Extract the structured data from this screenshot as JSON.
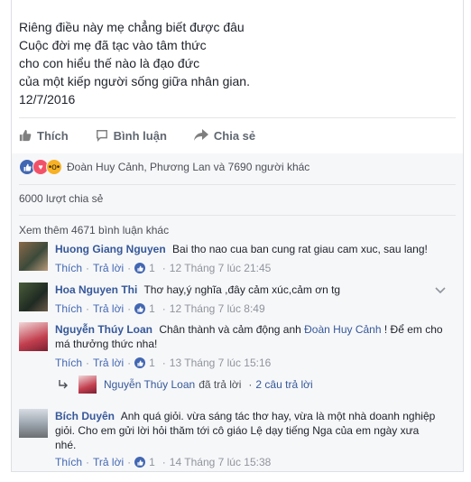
{
  "post": {
    "poem_lines": [
      "Riêng điều này mẹ chẳng biết được đâu",
      "Cuộc đời mẹ đã tạc vào tâm thức",
      "cho con hiểu thế nào là đạo đức",
      "của một kiếp người sống giữa nhân gian.",
      "12/7/2016"
    ]
  },
  "actions": {
    "like": "Thích",
    "comment": "Bình luận",
    "share": "Chia sẻ"
  },
  "reactions": {
    "names": "Đoàn Huy Cảnh, Phương Lan và 7690 người khác"
  },
  "shares": "6000 lượt chia sẻ",
  "more_comments": "Xem thêm 4671 bình luận khác",
  "comments": [
    {
      "name": "Huong Giang Nguyen",
      "text": "Bai tho nao cua ban cung rat giau cam xuc, sau lang!",
      "like_label": "Thích",
      "reply_label": "Trả lời",
      "likes": "1",
      "time": "12 Tháng 7 lúc 21:45"
    },
    {
      "name": "Hoa Nguyen Thi",
      "text": "Thơ hay,ý nghĩa ,đây cảm xúc,cảm ơn tg",
      "like_label": "Thích",
      "reply_label": "Trả lời",
      "likes": "1",
      "time": "12 Tháng 7 lúc 8:49"
    },
    {
      "name": "Nguyễn Thúy Loan",
      "text_before": "Chân thành và cảm động anh",
      "tag": "Đoàn Huy Cảnh",
      "text_after": "! Để em cho má thưởng thức nha!",
      "like_label": "Thích",
      "reply_label": "Trả lời",
      "likes": "1",
      "time": "13 Tháng 7 lúc 15:16",
      "reply_summary": {
        "name": "Nguyễn Thúy Loan",
        "action": "đã trả lời",
        "count": "2 câu trả lời"
      }
    },
    {
      "name": "Bích Duyên",
      "text": "Anh quá giỏi. vừa sáng tác thơ hay, vừa là một nhà doanh nghiệp giỏi. Cho em gửi lời hỏi thăm tới cô giáo Lệ dạy tiếng Nga của em ngày xưa nhé.",
      "like_label": "Thích",
      "reply_label": "Trả lời",
      "likes": "1",
      "time": "14 Tháng 7 lúc 15:38"
    }
  ],
  "colors": {
    "link": "#365899",
    "like_blue": "#4267b2",
    "love_red": "#f25268",
    "wow_yellow": "#f7b125"
  }
}
